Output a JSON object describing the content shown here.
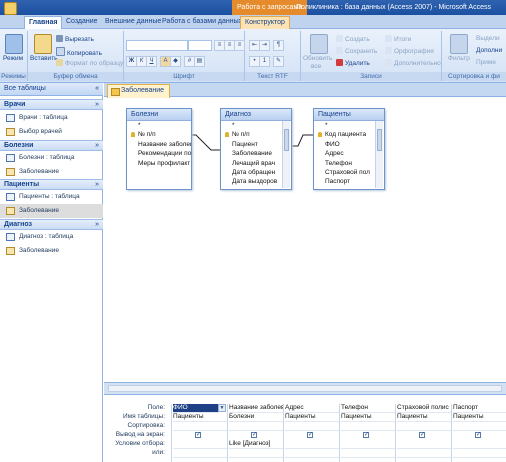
{
  "titlebar": {
    "context_tab": "Работа с запросами",
    "title": "Поликлиника : база данных (Access 2007) - Microsoft Access"
  },
  "tabs": [
    {
      "label": "Главная",
      "active": true
    },
    {
      "label": "Создание"
    },
    {
      "label": "Внешние данные"
    },
    {
      "label": "Работа с базами данных"
    },
    {
      "label": "Конструктор",
      "context": true
    }
  ],
  "ribbon": {
    "groups": {
      "modes": "Режимы",
      "clipboard": "Буфер обмена",
      "font": "Шрифт",
      "rtf": "Текст RTF",
      "records": "Записи",
      "sort": "Сортировка и фи"
    },
    "mode_btn": "Режим",
    "paste_btn": "Вставить",
    "cut": "Вырезать",
    "copy": "Копировать",
    "format_painter": "Формат по образцу",
    "refresh": "Обновить",
    "refresh2": "все",
    "new": "Создать",
    "save": "Сохранить",
    "delete": "Удалить",
    "totals": "Итоги",
    "spelling": "Орфография",
    "more": "Дополнительно",
    "filter": "Фильтр",
    "select": "Выдели",
    "advanced": "Дополни",
    "toggle": "Приме"
  },
  "nav": {
    "header": "Все таблицы",
    "groups": [
      {
        "title": "Врачи",
        "items": [
          {
            "label": "Врачи : таблица",
            "type": "table"
          },
          {
            "label": "Выбор врачей",
            "type": "query"
          }
        ]
      },
      {
        "title": "Болезни",
        "items": [
          {
            "label": "Болезни : таблица",
            "type": "table"
          },
          {
            "label": "Заболевание",
            "type": "query"
          }
        ]
      },
      {
        "title": "Пациенты",
        "items": [
          {
            "label": "Пациенты : таблица",
            "type": "table"
          },
          {
            "label": "Заболевание",
            "type": "query",
            "selected": true
          }
        ]
      },
      {
        "title": "Диагноз",
        "items": [
          {
            "label": "Диагноз : таблица",
            "type": "table"
          },
          {
            "label": "Заболевание",
            "type": "query"
          }
        ]
      }
    ]
  },
  "doc_tab": "Заболевание",
  "tables": [
    {
      "title": "Болезни",
      "fields": [
        "*",
        "№ п/п",
        "Название заболев",
        "Рекомендации по",
        "Меры профилакт"
      ],
      "key": 1
    },
    {
      "title": "Диагноз",
      "fields": [
        "*",
        "№ п/п",
        "Пациент",
        "Заболевание",
        "Лечащий врач",
        "Дата обращен",
        "Дата выздоров"
      ],
      "key": 1
    },
    {
      "title": "Пациенты",
      "fields": [
        "*",
        "Код пациента",
        "ФИО",
        "Адрес",
        "Телефон",
        "Страховой пол",
        "Паспорт"
      ],
      "key": 1
    }
  ],
  "qbe": {
    "row_labels": [
      "Поле:",
      "Имя таблицы:",
      "Сортировка:",
      "Вывод на экран:",
      "Условие отбора:",
      "или:"
    ],
    "columns": [
      {
        "field": "ФИО",
        "table": "Пациенты",
        "show": true,
        "criteria": ""
      },
      {
        "field": "Название заболеван",
        "table": "Болезни",
        "show": true,
        "criteria": "Like [Диагноз]"
      },
      {
        "field": "Адрес",
        "table": "Пациенты",
        "show": true,
        "criteria": ""
      },
      {
        "field": "Телефон",
        "table": "Пациенты",
        "show": true,
        "criteria": ""
      },
      {
        "field": "Страховой полис",
        "table": "Пациенты",
        "show": true,
        "criteria": ""
      },
      {
        "field": "Паспорт",
        "table": "Пациенты",
        "show": true,
        "criteria": ""
      }
    ]
  },
  "colors": {
    "accent": "#2f63b0",
    "ribbon": "#d3e2f6",
    "context_tab": "#e58b2c"
  }
}
